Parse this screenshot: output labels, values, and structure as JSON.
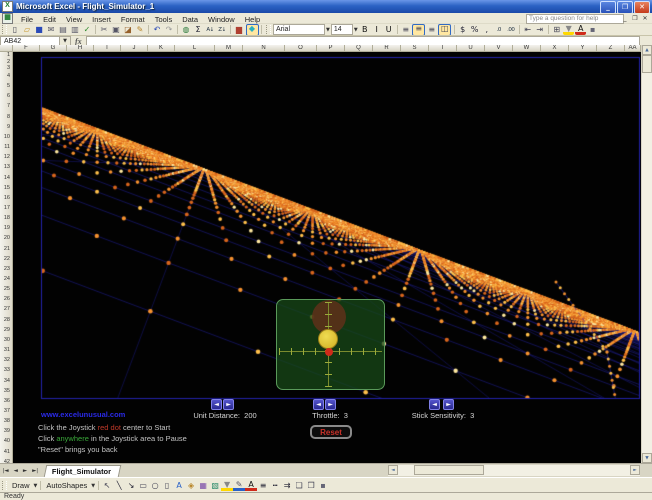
{
  "window": {
    "title": "Microsoft Excel - Flight_Simulator_1",
    "buttons": {
      "minimize": "_",
      "maximize": "❐",
      "close": "✕"
    }
  },
  "menu": {
    "items": [
      "File",
      "Edit",
      "View",
      "Insert",
      "Format",
      "Tools",
      "Data",
      "Window",
      "Help"
    ],
    "help_placeholder": "Type a question for help",
    "window_buttons": [
      "_",
      "❐",
      "✕"
    ]
  },
  "toolbar": {
    "font_name": "Arial",
    "font_size": "14",
    "standard_icons": [
      {
        "name": "new-document-icon",
        "glyph": "▯",
        "color": "#445"
      },
      {
        "name": "open-icon",
        "glyph": "▱",
        "color": "#c8962a"
      },
      {
        "name": "save-icon",
        "glyph": "■",
        "color": "#2a4ab8"
      },
      {
        "name": "email-icon",
        "glyph": "✉",
        "color": "#556"
      },
      {
        "name": "print-icon",
        "glyph": "▤",
        "color": "#556"
      },
      {
        "name": "print-preview-icon",
        "glyph": "▥",
        "color": "#556"
      },
      {
        "name": "spelling-icon",
        "glyph": "✓",
        "color": "#2a8a2a"
      },
      {
        "name": "separator",
        "glyph": ""
      },
      {
        "name": "cut-icon",
        "glyph": "✂",
        "color": "#556"
      },
      {
        "name": "copy-icon",
        "glyph": "▣",
        "color": "#556"
      },
      {
        "name": "paste-icon",
        "glyph": "◪",
        "color": "#96602a"
      },
      {
        "name": "format-painter-icon",
        "glyph": "✎",
        "color": "#b8862a"
      },
      {
        "name": "separator",
        "glyph": ""
      },
      {
        "name": "undo-icon",
        "glyph": "↶",
        "color": "#2a4ab8"
      },
      {
        "name": "redo-icon",
        "glyph": "↷",
        "color": "#9a9a9a"
      },
      {
        "name": "separator",
        "glyph": ""
      },
      {
        "name": "hyperlink-icon",
        "glyph": "◍",
        "color": "#2a7a3a"
      },
      {
        "name": "autosum-icon",
        "glyph": "Σ",
        "color": "#223"
      },
      {
        "name": "sort-ascending-icon",
        "glyph": "A↓",
        "color": "#234",
        "small": true
      },
      {
        "name": "sort-descending-icon",
        "glyph": "Z↓",
        "color": "#234",
        "small": true
      },
      {
        "name": "separator",
        "glyph": ""
      },
      {
        "name": "chart-wizard-icon",
        "glyph": "▆",
        "color": "#b04030"
      },
      {
        "name": "drawing-toggle-icon",
        "glyph": "◆",
        "color": "#2ab0c0",
        "pressed": true
      },
      {
        "name": "separator",
        "glyph": ""
      }
    ],
    "format_icons": [
      {
        "name": "bold-icon",
        "glyph": "B",
        "color": "#111"
      },
      {
        "name": "italic-icon",
        "glyph": "I",
        "color": "#111"
      },
      {
        "name": "underline-icon",
        "glyph": "U",
        "color": "#111"
      },
      {
        "name": "separator",
        "glyph": ""
      },
      {
        "name": "align-left-icon",
        "glyph": "≡",
        "color": "#445"
      },
      {
        "name": "align-center-icon",
        "glyph": "≡",
        "color": "#445",
        "pressed": true
      },
      {
        "name": "align-right-icon",
        "glyph": "≡",
        "color": "#445"
      },
      {
        "name": "merge-center-icon",
        "glyph": "◫",
        "color": "#445",
        "pressed": true
      },
      {
        "name": "separator",
        "glyph": ""
      },
      {
        "name": "currency-icon",
        "glyph": "$",
        "color": "#223"
      },
      {
        "name": "percent-icon",
        "glyph": "%",
        "color": "#223"
      },
      {
        "name": "comma-icon",
        "glyph": ",",
        "color": "#223"
      },
      {
        "name": "increase-decimal-icon",
        "glyph": ".0",
        "color": "#234",
        "small": true
      },
      {
        "name": "decrease-decimal-icon",
        "glyph": ".00",
        "color": "#234",
        "small": true
      },
      {
        "name": "separator",
        "glyph": ""
      },
      {
        "name": "decrease-indent-icon",
        "glyph": "⇤",
        "color": "#445"
      },
      {
        "name": "increase-indent-icon",
        "glyph": "⇥",
        "color": "#445"
      },
      {
        "name": "separator",
        "glyph": ""
      },
      {
        "name": "borders-icon",
        "glyph": "⊞",
        "color": "#445"
      },
      {
        "name": "fill-color-icon",
        "glyph": "▼",
        "color": "#888",
        "bar": "#ffd800"
      },
      {
        "name": "font-color-icon",
        "glyph": "A",
        "color": "#111",
        "bar": "#d02a1a"
      },
      {
        "name": "toolbar-options-icon",
        "glyph": "▪",
        "color": "#667"
      }
    ]
  },
  "formula_bar": {
    "cell_reference": "AB42",
    "fx_label": "fx",
    "formula_value": ""
  },
  "sheet": {
    "columns": [
      "F",
      "G",
      "H",
      "I",
      "J",
      "K",
      "L",
      "M",
      "N",
      "O",
      "P",
      "Q",
      "R",
      "S",
      "T",
      "U",
      "V",
      "W",
      "X",
      "Y",
      "Z",
      "AA"
    ],
    "rows": [
      "1",
      "2",
      "3",
      "4",
      "5",
      "6",
      "7",
      "8",
      "9",
      "10",
      "11",
      "12",
      "13",
      "14",
      "15",
      "16",
      "17",
      "18",
      "19",
      "20",
      "21",
      "22",
      "23",
      "24",
      "25",
      "26",
      "27",
      "28",
      "29",
      "30",
      "31",
      "32",
      "33",
      "34",
      "35",
      "36",
      "37",
      "38",
      "39",
      "40",
      "41",
      "42"
    ]
  },
  "game": {
    "url": "www.excelunusual.com",
    "instruction_lines": [
      [
        {
          "text": "Click the Joystick "
        },
        {
          "text": "red dot",
          "color": "#c23a2a"
        },
        {
          "text": " center to Start"
        }
      ],
      [
        {
          "text": "Click "
        },
        {
          "text": "anywhere",
          "color": "#3aa83a"
        },
        {
          "text": " in the Joystick area to Pause"
        }
      ],
      [
        {
          "text": "\"Reset\" brings you back"
        }
      ]
    ],
    "controls": [
      {
        "name": "unit-distance",
        "label": "Unit Distance:",
        "value": "200"
      },
      {
        "name": "throttle",
        "label": "Throttle:",
        "value": "3"
      },
      {
        "name": "stick-sensitivity",
        "label": "Stick Sensitivity:",
        "value": "3"
      }
    ],
    "reset_label": "Reset",
    "spinner_glyphs": {
      "left": "◄",
      "right": "►"
    },
    "terrain": {
      "background": "#020202",
      "border_color": "#2222aa",
      "line_color": "#2b2bd0",
      "dot_colors": [
        "#d8651c",
        "#f5912e",
        "#ffc04a",
        "#ffe9a0"
      ]
    }
  },
  "sheet_tabs": {
    "active": "Flight_Simulator",
    "nav": [
      "|◄",
      "◄",
      "►",
      "►|"
    ]
  },
  "drawing_toolbar": {
    "draw_label": "Draw",
    "autoshapes_label": "AutoShapes",
    "icons": [
      {
        "name": "select-objects-icon",
        "glyph": "↖",
        "color": "#445"
      },
      {
        "name": "line-icon",
        "glyph": "╲",
        "color": "#223"
      },
      {
        "name": "arrow-icon",
        "glyph": "↘",
        "color": "#223"
      },
      {
        "name": "rectangle-icon",
        "glyph": "▭",
        "color": "#445"
      },
      {
        "name": "oval-icon",
        "glyph": "○",
        "color": "#445"
      },
      {
        "name": "textbox-icon",
        "glyph": "▯",
        "color": "#445"
      },
      {
        "name": "wordart-icon",
        "glyph": "A",
        "color": "#2a62c8"
      },
      {
        "name": "diagram-icon",
        "glyph": "◈",
        "color": "#b8862a"
      },
      {
        "name": "clipart-icon",
        "glyph": "▦",
        "color": "#7a4aa8"
      },
      {
        "name": "picture-icon",
        "glyph": "▧",
        "color": "#2a8a6a"
      },
      {
        "name": "fill-color-icon",
        "glyph": "▼",
        "color": "#888",
        "bar": "#ffd800"
      },
      {
        "name": "line-color-icon",
        "glyph": "✎",
        "color": "#556",
        "bar": "#2a62c8"
      },
      {
        "name": "font-color-icon",
        "glyph": "A",
        "color": "#111",
        "bar": "#d02a1a"
      },
      {
        "name": "line-style-icon",
        "glyph": "≡",
        "color": "#223"
      },
      {
        "name": "dash-style-icon",
        "glyph": "┅",
        "color": "#223"
      },
      {
        "name": "arrow-style-icon",
        "glyph": "⇉",
        "color": "#223"
      },
      {
        "name": "shadow-style-icon",
        "glyph": "❏",
        "color": "#445"
      },
      {
        "name": "threed-style-icon",
        "glyph": "❒",
        "color": "#445"
      },
      {
        "name": "toolbar-options-icon",
        "glyph": "▪",
        "color": "#667"
      }
    ]
  },
  "status_bar": {
    "message": "Ready"
  }
}
